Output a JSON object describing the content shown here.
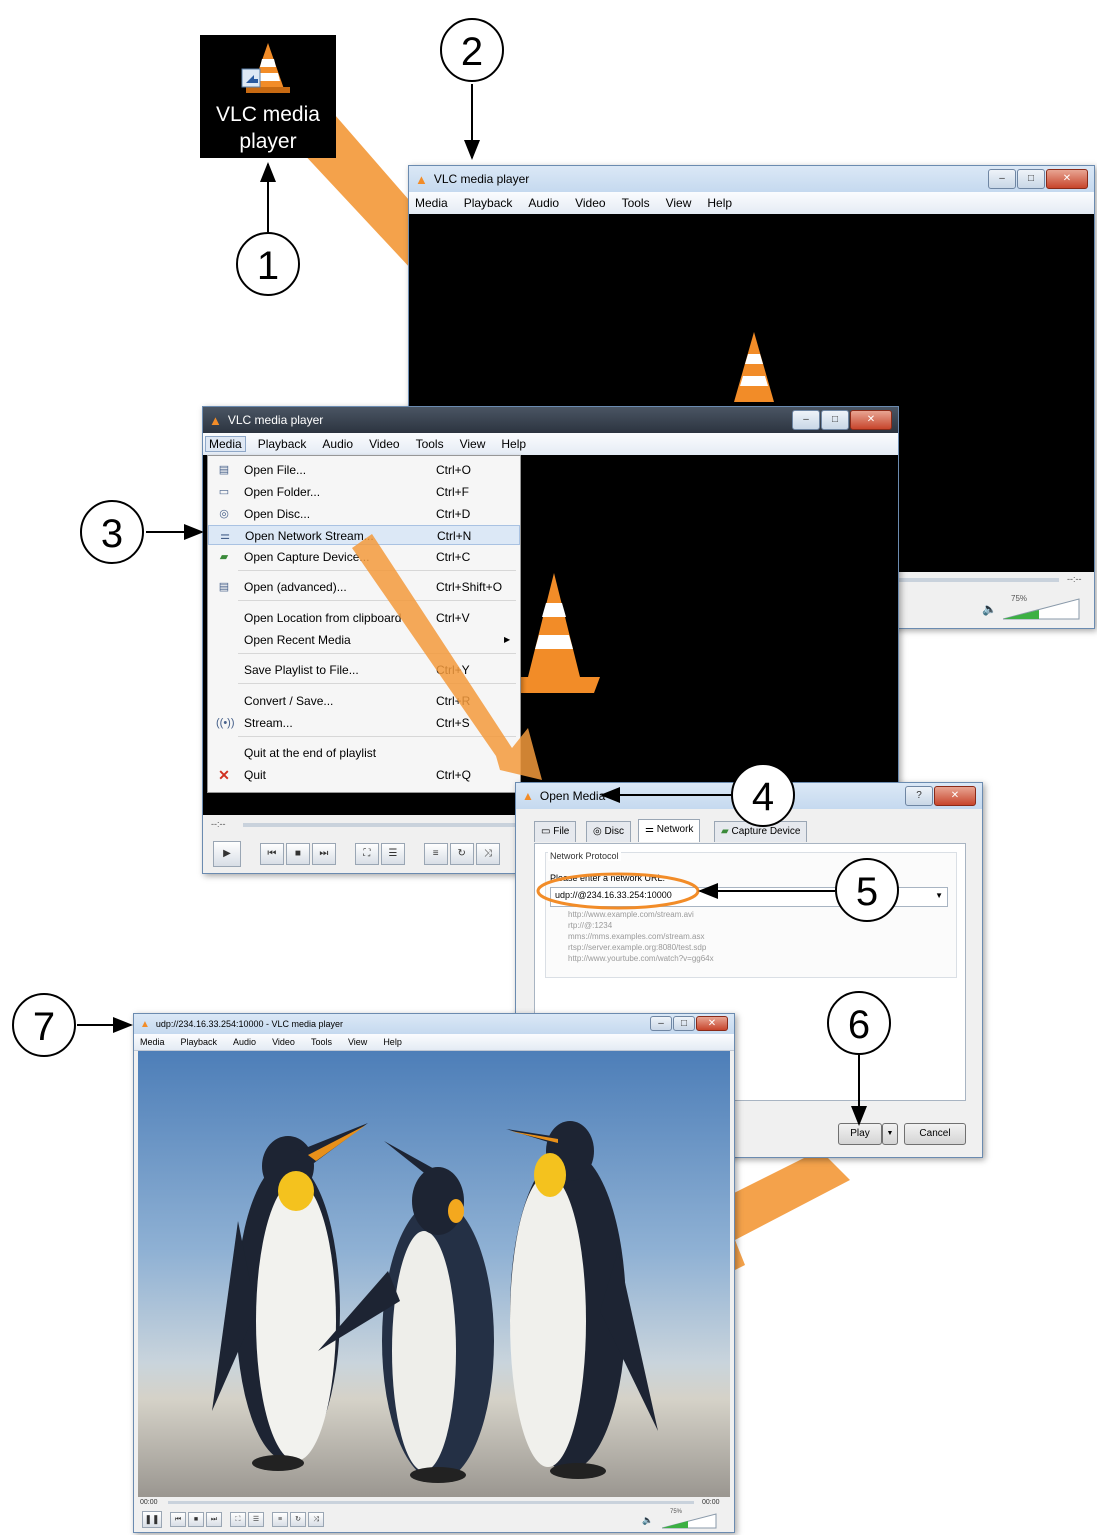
{
  "desktop_icon": {
    "label_line1": "VLC media",
    "label_line2": "player"
  },
  "steps": [
    "1",
    "2",
    "3",
    "4",
    "5",
    "6",
    "7"
  ],
  "window1": {
    "title": "VLC media player",
    "menu": [
      "Media",
      "Playback",
      "Audio",
      "Video",
      "Tools",
      "View",
      "Help"
    ],
    "time": "--:--",
    "volume": "75%"
  },
  "window2": {
    "title": "VLC media player",
    "menu": [
      "Media",
      "Playback",
      "Audio",
      "Video",
      "Tools",
      "View",
      "Help"
    ],
    "time": "--:--",
    "media_menu": [
      {
        "icon": "file-icon",
        "label": "Open File...",
        "shortcut": "Ctrl+O"
      },
      {
        "icon": "folder-icon",
        "label": "Open Folder...",
        "shortcut": "Ctrl+F"
      },
      {
        "icon": "disc-icon",
        "label": "Open Disc...",
        "shortcut": "Ctrl+D"
      },
      {
        "icon": "network-icon",
        "label": "Open Network Stream...",
        "shortcut": "Ctrl+N"
      },
      {
        "icon": "capture-icon",
        "label": "Open Capture Device...",
        "shortcut": "Ctrl+C"
      },
      {
        "icon": "file-icon",
        "label": "Open (advanced)...",
        "shortcut": "Ctrl+Shift+O"
      },
      {
        "icon": "",
        "label": "Open Location from clipboard",
        "shortcut": "Ctrl+V"
      },
      {
        "icon": "",
        "label": "Open Recent Media",
        "shortcut": ""
      },
      {
        "icon": "",
        "label": "Save Playlist to File...",
        "shortcut": "Ctrl+Y"
      },
      {
        "icon": "",
        "label": "Convert / Save...",
        "shortcut": "Ctrl+R"
      },
      {
        "icon": "stream-icon",
        "label": "Stream...",
        "shortcut": "Ctrl+S"
      },
      {
        "icon": "",
        "label": "Quit at the end of playlist",
        "shortcut": ""
      },
      {
        "icon": "quit-icon",
        "label": "Quit",
        "shortcut": "Ctrl+Q"
      }
    ]
  },
  "open_media": {
    "title": "Open Media",
    "tabs": [
      "File",
      "Disc",
      "Network",
      "Capture Device"
    ],
    "group_label": "Network Protocol",
    "url_label": "Please enter a network URL:",
    "url_value": "udp://@234.16.33.254:10000",
    "examples": [
      "http://www.example.com/stream.avi",
      "rtp://@:1234",
      "mms://mms.examples.com/stream.asx",
      "rtsp://server.example.org:8080/test.sdp",
      "http://www.yourtube.com/watch?v=gg64x"
    ],
    "play_label": "Play",
    "cancel_label": "Cancel"
  },
  "window3": {
    "title": "udp://234.16.33.254:10000 - VLC media player",
    "menu": [
      "Media",
      "Playback",
      "Audio",
      "Video",
      "Tools",
      "View",
      "Help"
    ],
    "time_start": "00:00",
    "time_end": "00:00",
    "volume": "75%"
  },
  "colors": {
    "arrow": "#f39a3c",
    "vlc_orange": "#f28c28",
    "titlebar_dark": "#2c3440"
  }
}
